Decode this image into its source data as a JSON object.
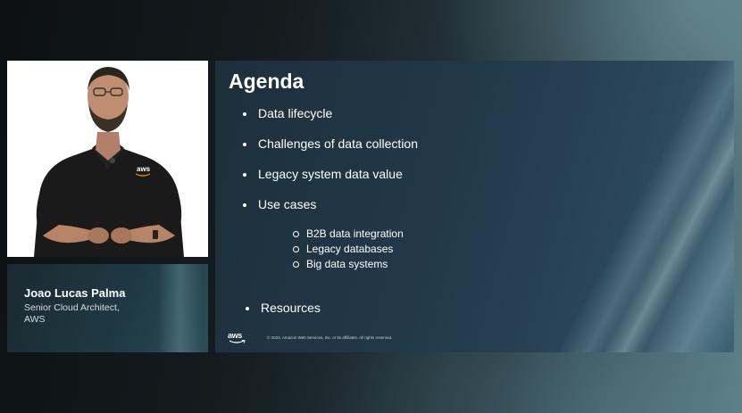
{
  "speaker": {
    "name": "Joao Lucas Palma",
    "role_line1": "Senior Cloud Architect,",
    "role_line2": "AWS",
    "shirt_logo": "aws"
  },
  "slide": {
    "title": "Agenda",
    "bullets": [
      {
        "label": "Data lifecycle"
      },
      {
        "label": "Challenges of data collection"
      },
      {
        "label": "Legacy system data value"
      },
      {
        "label": "Use cases"
      }
    ],
    "sub_bullets": [
      {
        "label": "B2B data integration"
      },
      {
        "label": "Legacy databases"
      },
      {
        "label": "Big data systems"
      }
    ],
    "final_bullet": "Resources",
    "footer": {
      "logo_text": "aws",
      "copyright": "© 2023, Amazon Web Services, Inc. or its affiliates. All rights reserved."
    }
  },
  "colors": {
    "slide_bg": "#22394a",
    "name_card_bg": "#1f3a44",
    "text": "#ffffff",
    "aws_orange": "#ff9900"
  }
}
